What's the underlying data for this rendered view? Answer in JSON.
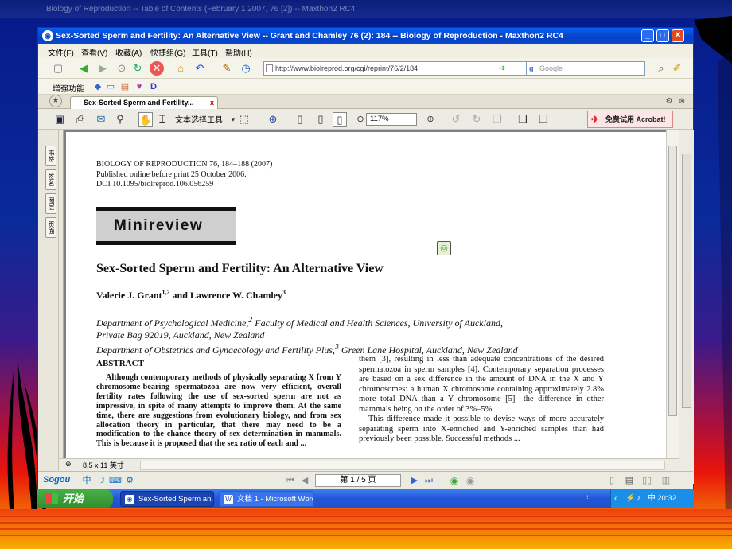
{
  "background_tab_title": "Biology of Reproduction -- Table of Contents (February 1 2007, 76 [2]) -- Maxthon2 RC4",
  "window": {
    "title": "Sex-Sorted Sperm and Fertility: An Alternative View -- Grant and Chamley 76 (2): 184 -- Biology of Reproduction - Maxthon2 RC4",
    "btn_min": "_",
    "btn_max": "□",
    "btn_close": "✕"
  },
  "menu": [
    "文件(F)",
    "查看(V)",
    "收藏(A)",
    "快捷组(G)",
    "工具(T)",
    "帮助(H)"
  ],
  "address": {
    "url": "http://www.biolreprod.org/cgi/reprint/76/2/184"
  },
  "search": {
    "placeholder": "Google"
  },
  "toolbar2": {
    "label": "增强功能"
  },
  "tab": {
    "title": "Sex-Sorted Sperm and Fertility...",
    "close": "x"
  },
  "pdf_toolbar": {
    "text_select": "文本选择工具",
    "zoom": "117%",
    "acrobat_button": "免费试用 Acrobat!"
  },
  "side_tabs": [
    "书签",
    "签名",
    "图层",
    "页面"
  ],
  "page": {
    "journal_line": "BIOLOGY OF REPRODUCTION 76, 184–188 (2007)",
    "published": "Published online before print 25 October 2006.",
    "doi": "DOI 10.1095/biolreprod.106.056259",
    "section_badge": "Minireview",
    "title": "Sex-Sorted Sperm and Fertility: An Alternative View",
    "author1": "Valerie J. Grant",
    "author1_sup": "1,2",
    "author_and": " and Lawrence W. Chamley",
    "author2_sup": "3",
    "affil1": "Department of Psychological Medicine,",
    "affil1_sup": "2",
    "affil1_rest": " Faculty of Medical and Health Sciences, University of Auckland,",
    "affil2": "Private Bag 92019, Auckland, New Zealand",
    "affil3": "Department of Obstetrics and Gynaecology and Fertility Plus,",
    "affil3_sup": "3",
    "affil3_rest": " Green Lane Hospital, Auckland, New Zealand",
    "abstract_heading": "ABSTRACT",
    "abstract": "Although contemporary methods of physically separating X from Y chromosome-bearing spermatozoa are now very efficient, overall fertility rates following the use of sex-sorted sperm are not as impressive, in spite of many attempts to improve them. At the same time, there are suggestions from evolutionary biology, and from sex allocation theory in particular, that there may need to be a modification to the chance theory of sex determination in mammals. This is because it is proposed that the sex ratio of each and ...",
    "col2_p1": "them [3], resulting in less than adequate concentrations of the desired spermatozoa in sperm samples [4]. Contemporary separation processes are based on a sex difference in the amount of DNA in the X and Y chromosomes: a human X chromosome containing approximately 2.8% more total DNA than a Y chromosome [5]—the difference in other mammals being on the order of 3%–5%.",
    "col2_p2": "This difference made it possible to devise ways of more accurately separating sperm into X-enriched and Y-enriched samples than had previously been possible. Successful methods ..."
  },
  "doc_status": {
    "page_size": "8.5 x 11 英寸"
  },
  "status": {
    "sogou": "Sogou",
    "page_nav": "第 1 / 5 页"
  },
  "taskbar": {
    "start": "开始",
    "tasks": [
      "Sex-Sorted Sperm an...",
      "文档 1 - Microsoft Word"
    ],
    "clock": "20:32"
  }
}
